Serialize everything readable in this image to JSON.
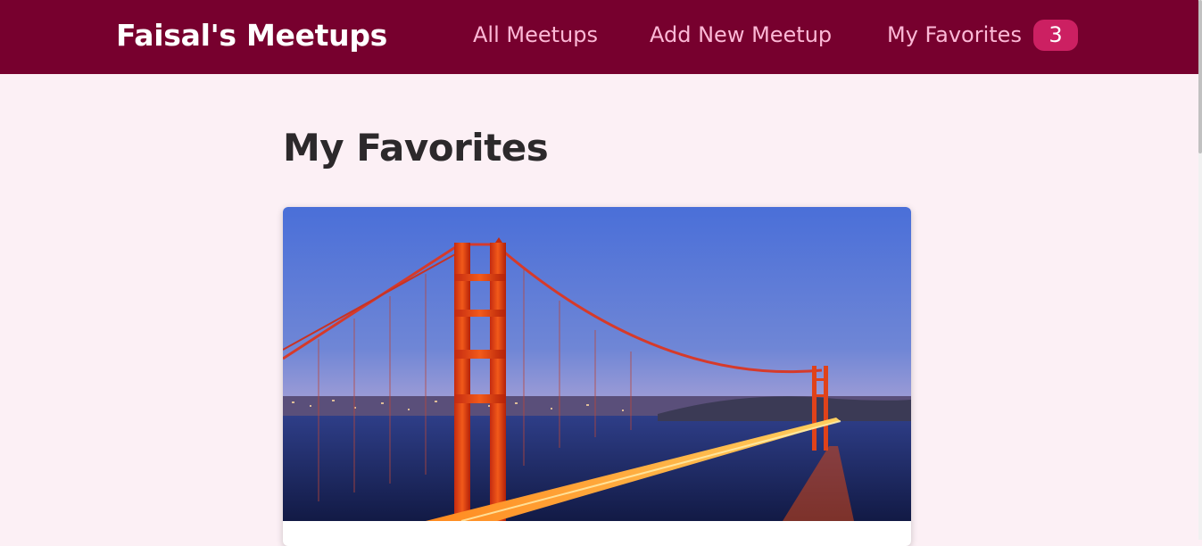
{
  "header": {
    "logo": "Faisal's Meetups",
    "nav": {
      "all_meetups": "All Meetups",
      "add_new_meetup": "Add New Meetup",
      "my_favorites": "My Favorites",
      "favorites_count": "3"
    }
  },
  "main": {
    "title": "My Favorites",
    "cards": [
      {
        "image": "golden-gate-bridge-night-photo"
      }
    ]
  },
  "colors": {
    "header_bg": "#77002e",
    "nav_link": "#fcb8d6",
    "badge_bg": "#cc2062",
    "page_bg": "#fcf0f5"
  }
}
